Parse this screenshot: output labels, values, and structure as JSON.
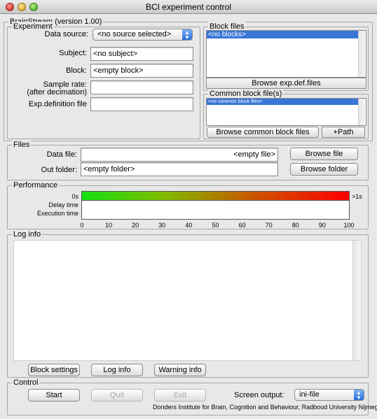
{
  "window": {
    "title": "BCI experiment control"
  },
  "main_group": {
    "legend": "BrainStream (version 1.00)"
  },
  "experiment": {
    "legend": "Experiment",
    "data_source_label": "Data source:",
    "data_source_value": "<no source selected>",
    "subject_label": "Subject:",
    "subject_value": "<no subject>",
    "block_label": "Block:",
    "block_value": "<empty block>",
    "sample_rate_label_1": "Sample rate:",
    "sample_rate_label_2": "(after decimation)",
    "sample_rate_value": "",
    "expdef_label": "Exp.definition file",
    "expdef_value": ""
  },
  "block_files": {
    "legend": "Block files",
    "items": [
      "<no blocks>"
    ],
    "browse_label": "Browse exp.def.files"
  },
  "common_block": {
    "legend": "Common block file(s)",
    "items": [
      "<no common block files>"
    ],
    "browse_label": "Browse common block files",
    "path_label": "+Path"
  },
  "files": {
    "legend": "Files",
    "data_file_label": "Data file:",
    "data_file_value": "<empty file>",
    "out_folder_label": "Out folder:",
    "out_folder_value": "<empty folder>",
    "browse_file_label": "Browse file",
    "browse_folder_label": "Browse folder"
  },
  "performance": {
    "legend": "Performance",
    "row_labels": [
      "0s",
      "Delay time",
      "Execution time"
    ],
    "scale_end_label": ">1s",
    "ticks": [
      "0",
      "10",
      "20",
      "30",
      "40",
      "50",
      "60",
      "70",
      "80",
      "90",
      "100"
    ],
    "colors": {
      "low": "#15e015",
      "high": "#ff0000"
    }
  },
  "log": {
    "legend": "Log info",
    "content": "",
    "block_settings_label": "Block settings",
    "log_info_label": "Log info",
    "warning_info_label": "Warning info"
  },
  "control": {
    "legend": "Control",
    "start_label": "Start",
    "quit_label": "Quit",
    "exit_label": "Exit",
    "screen_output_label": "Screen output:",
    "screen_output_value": "ini-file"
  },
  "footer": {
    "text": "Donders Institute for Brain, Cognition and Behaviour, Radboud University Nijmegen"
  },
  "icons": {
    "window_controls": [
      "close-icon",
      "minimize-icon",
      "zoom-icon"
    ],
    "popup_arrows": "up-down-arrows-icon"
  }
}
